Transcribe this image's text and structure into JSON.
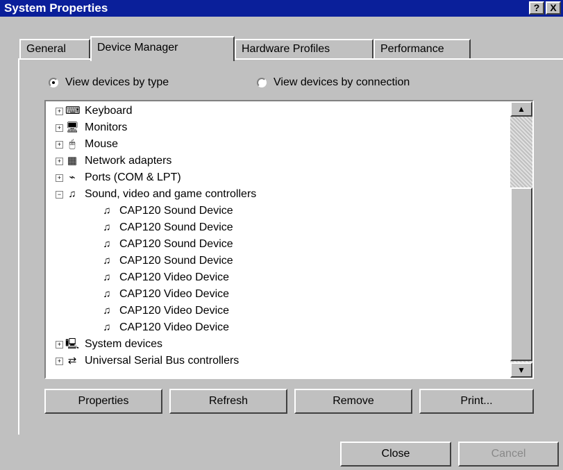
{
  "window": {
    "title": "System Properties"
  },
  "title_buttons": {
    "help": "?",
    "close": "X"
  },
  "tabs": [
    {
      "label": "General"
    },
    {
      "label": "Device Manager"
    },
    {
      "label": "Hardware Profiles"
    },
    {
      "label": "Performance"
    }
  ],
  "view": {
    "by_type": "View devices by type",
    "by_connection": "View devices by connection",
    "selected": "by_type"
  },
  "tree": {
    "items": [
      {
        "label": "Keyboard",
        "icon": "keyboard-icon"
      },
      {
        "label": "Monitors",
        "icon": "monitor-icon"
      },
      {
        "label": "Mouse",
        "icon": "mouse-icon"
      },
      {
        "label": "Network adapters",
        "icon": "network-adapter-icon"
      },
      {
        "label": "Ports (COM & LPT)",
        "icon": "port-icon"
      },
      {
        "label": "Sound, video and game controllers",
        "icon": "sound-controller-icon"
      },
      {
        "label": "CAP120 Sound Device",
        "icon": "sound-device-icon"
      },
      {
        "label": "CAP120 Sound Device",
        "icon": "sound-device-icon"
      },
      {
        "label": "CAP120 Sound Device",
        "icon": "sound-device-icon"
      },
      {
        "label": "CAP120 Sound Device",
        "icon": "sound-device-icon"
      },
      {
        "label": "CAP120 Video Device",
        "icon": "video-device-icon"
      },
      {
        "label": "CAP120 Video Device",
        "icon": "video-device-icon"
      },
      {
        "label": "CAP120 Video Device",
        "icon": "video-device-icon"
      },
      {
        "label": "CAP120 Video Device",
        "icon": "video-device-icon"
      },
      {
        "label": "System devices",
        "icon": "system-devices-icon"
      },
      {
        "label": "Universal Serial Bus controllers",
        "icon": "usb-icon"
      }
    ]
  },
  "buttons": {
    "properties": "Properties",
    "refresh": "Refresh",
    "remove": "Remove",
    "print": "Print...",
    "close": "Close",
    "cancel": "Cancel"
  }
}
